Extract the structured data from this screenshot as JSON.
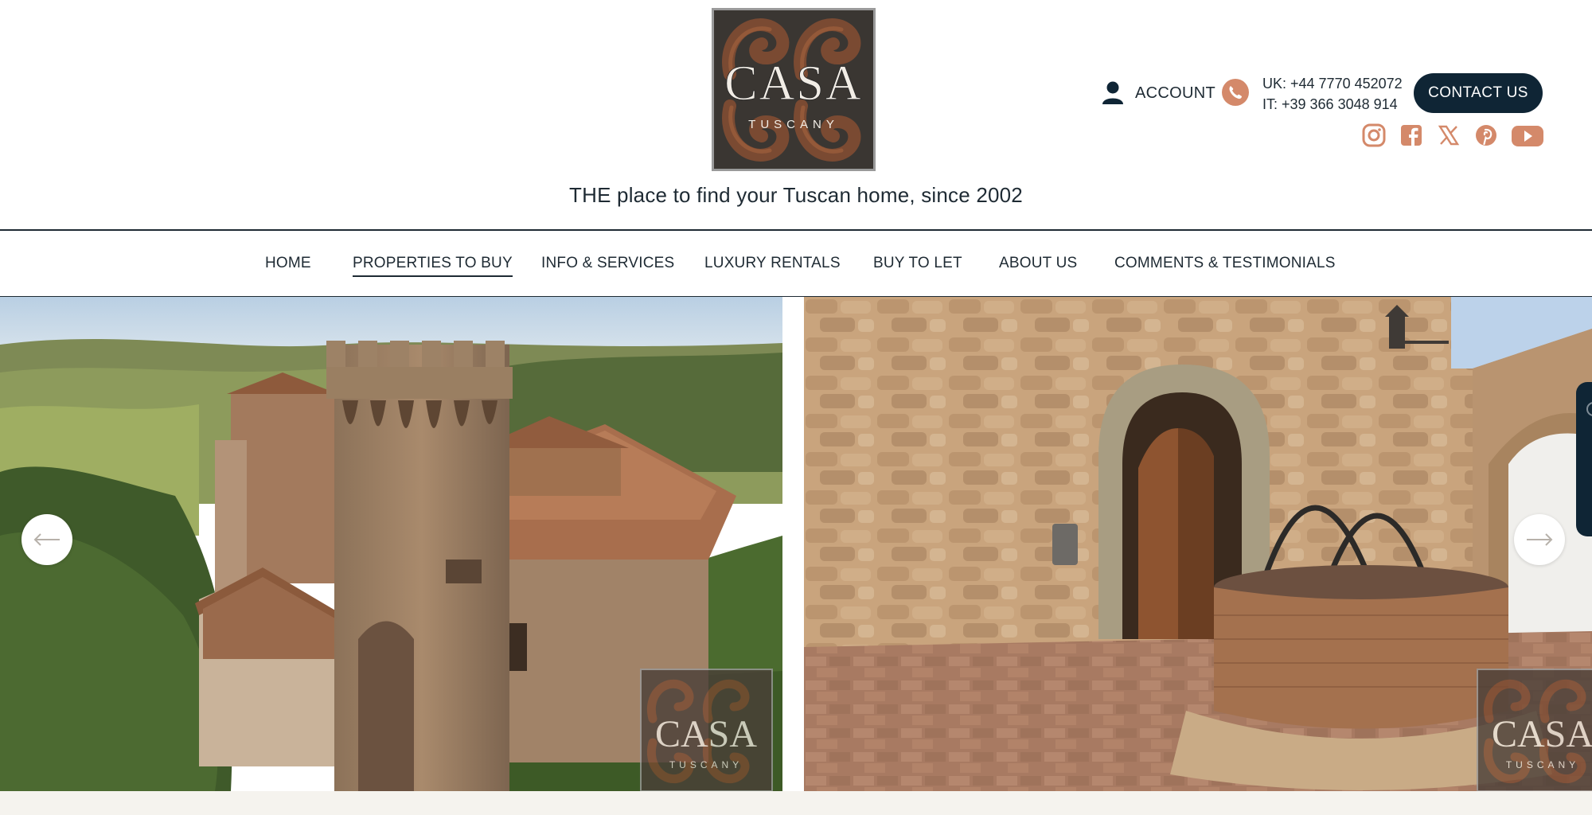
{
  "brand": {
    "logo_word": "CASA",
    "logo_sub": "TUSCANY",
    "tagline": "THE place to find your Tuscan home, since 2002"
  },
  "header": {
    "account_label": "ACCOUNT",
    "phone_uk": "UK: +44 7770 452072",
    "phone_it": "IT: +39 366 3048 914",
    "contact_label": "CONTACT US",
    "social_icons": [
      "instagram-icon",
      "facebook-icon",
      "x-twitter-icon",
      "pinterest-icon",
      "youtube-icon"
    ]
  },
  "nav": {
    "items": [
      {
        "label": "HOME",
        "active": false
      },
      {
        "label": "PROPERTIES TO BUY",
        "active": true
      },
      {
        "label": "INFO & SERVICES",
        "active": false
      },
      {
        "label": "LUXURY RENTALS",
        "active": false
      },
      {
        "label": "BUY TO LET",
        "active": false
      },
      {
        "label": "ABOUT US",
        "active": false
      },
      {
        "label": "COMMENTS & TESTIMONIALS",
        "active": false
      }
    ]
  },
  "gallery": {
    "slides": [
      "castle-tower-photo",
      "courtyard-well-photo"
    ],
    "watermark_word": "CASA",
    "watermark_sub": "TUSCANY"
  },
  "colors": {
    "navy": "#0f2535",
    "text": "#1e2a33",
    "terracotta": "#d4896a",
    "footer_bg": "#f5f3ee"
  }
}
